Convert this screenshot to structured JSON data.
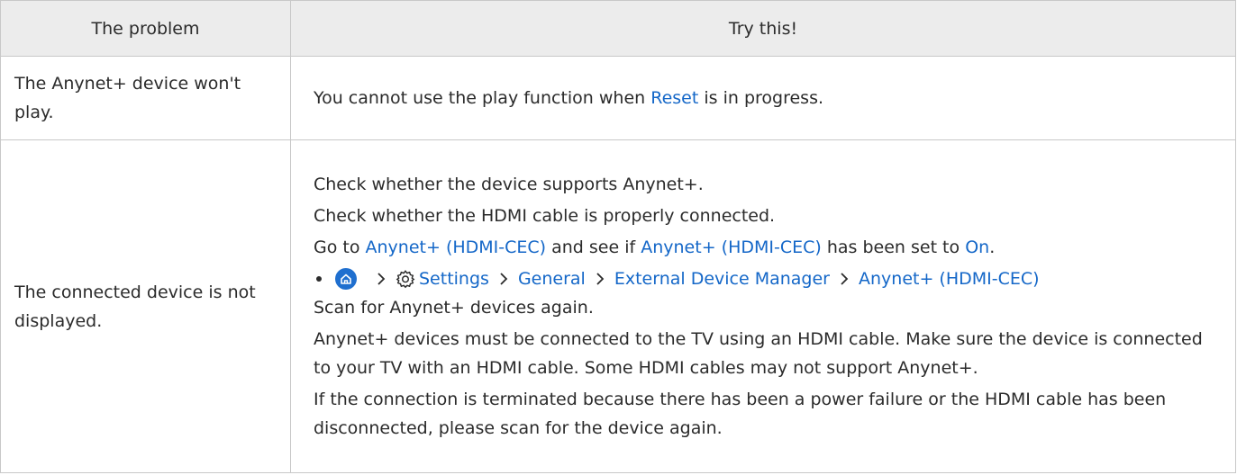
{
  "header": {
    "col1": "The problem",
    "col2": "Try this!"
  },
  "rows": [
    {
      "problem": "The Anynet+ device won't play.",
      "solution": {
        "pre": "You cannot use the play function when ",
        "link": "Reset",
        "post": " is in progress."
      }
    },
    {
      "problem": "The connected device is not displayed.",
      "lines": [
        "Check whether the device supports Anynet+.",
        "Check whether the HDMI cable is properly connected."
      ],
      "goto": {
        "pre": "Go to ",
        "link1": "Anynet+ (HDMI-CEC)",
        "mid": " and see if ",
        "link2": "Anynet+ (HDMI-CEC)",
        "mid2": " has been set to ",
        "link3": "On",
        "end": "."
      },
      "path": [
        "Settings",
        "General",
        "External Device Manager",
        "Anynet+ (HDMI-CEC)"
      ],
      "lines2": [
        "Scan for Anynet+ devices again.",
        "Anynet+ devices must be connected to the TV using an HDMI cable. Make sure the device is connected to your TV with an HDMI cable. Some HDMI cables may not support Anynet+.",
        "If the connection is terminated because there has been a power failure or the HDMI cable has been disconnected, please scan for the device again."
      ]
    }
  ],
  "colors": {
    "link": "#1467c8",
    "header_bg": "#ececec",
    "border": "#c8c8c8",
    "home_icon": "#1f6fcf"
  },
  "icons": {
    "home": "home-icon",
    "settings": "gear-icon",
    "separator": "chevron-right-icon"
  }
}
